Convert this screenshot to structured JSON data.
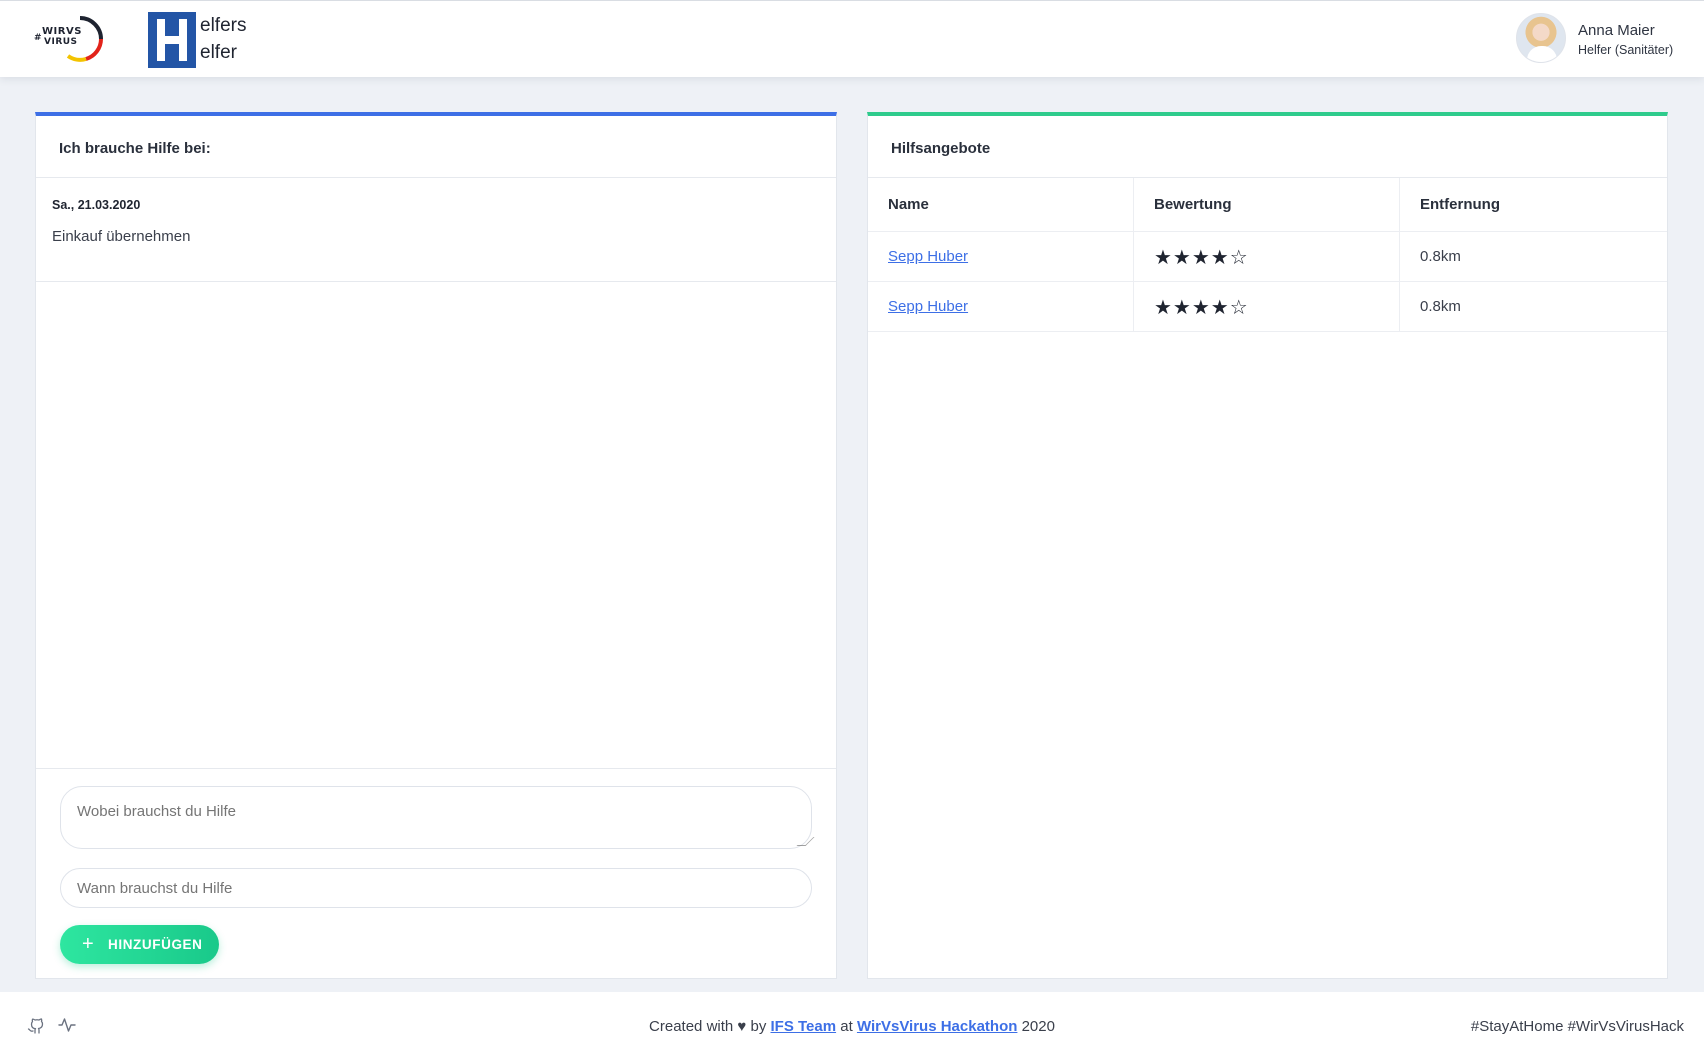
{
  "header": {
    "wirvsvirus_logo": {
      "hash": "#",
      "line1": "WIRVS",
      "line2": "VIRUS"
    },
    "app_logo": {
      "word1": "elfers",
      "word2": "elfer"
    },
    "user": {
      "name": "Anna Maier",
      "role": "Helfer (Sanitäter)"
    }
  },
  "left_card": {
    "title": "Ich brauche Hilfe bei:",
    "accent_color": "#3d6fe6",
    "requests": [
      {
        "date": "Sa., 21.03.2020",
        "text": "Einkauf übernehmen"
      }
    ],
    "form": {
      "what_placeholder": "Wobei brauchst du Hilfe",
      "when_placeholder": "Wann brauchst du Hilfe",
      "add_button_label": "HINZUFÜGEN",
      "add_button_icon": "plus-icon"
    }
  },
  "right_card": {
    "title": "Hilfsangebote",
    "accent_color": "#2ecb8c",
    "columns": [
      "Name",
      "Bewertung",
      "Entfernung"
    ],
    "rows": [
      {
        "name": "Sepp Huber",
        "rating": 4,
        "max_rating": 5,
        "distance": "0.8km"
      },
      {
        "name": "Sepp Huber",
        "rating": 4,
        "max_rating": 5,
        "distance": "0.8km"
      }
    ]
  },
  "footer": {
    "icons": [
      "github-icon",
      "activity-icon"
    ],
    "credit_prefix": "Created with ♥ by ",
    "credit_team": "IFS Team",
    "credit_mid": " at ",
    "credit_event": "WirVsVirus Hackathon",
    "credit_year": " 2020",
    "hashtags": "#StayAtHome #WirVsVirusHack"
  }
}
